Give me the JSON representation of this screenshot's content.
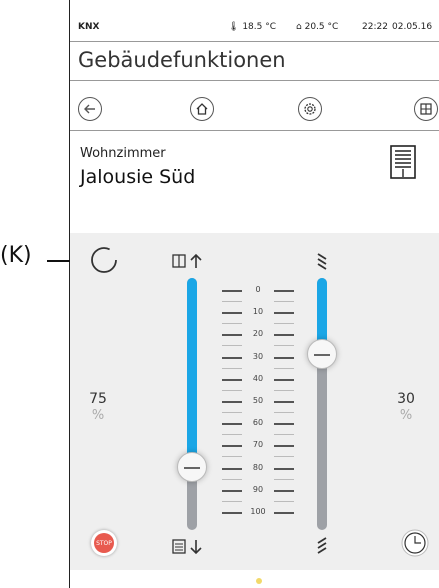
{
  "status": {
    "brand": "KNX",
    "outdoor_temp": "18.5 °C",
    "indoor_temp": "20.5 °C",
    "time": "22:22",
    "date": "02.05.16"
  },
  "header": {
    "title": "Gebäudefunktionen"
  },
  "nav": {
    "icons": [
      "back-arrow-icon",
      "home-icon",
      "settings-gear-icon",
      "grid-icon"
    ]
  },
  "device": {
    "room": "Wohnzimmer",
    "name": "Jalousie Süd",
    "icon": "blind-icon"
  },
  "callout": {
    "label": "(K)"
  },
  "left": {
    "value": "75",
    "unit": "%"
  },
  "right": {
    "value": "30",
    "unit": "%"
  },
  "position_level": 0.75,
  "slat_level": 0.3,
  "scale": [
    "0",
    "10",
    "20",
    "30",
    "40",
    "50",
    "60",
    "70",
    "80",
    "90",
    "100"
  ],
  "stop_label": "STOP",
  "colors": {
    "accent": "#1aa6e6",
    "stop": "#e85a4f",
    "page_dot": "#f2d96a"
  }
}
